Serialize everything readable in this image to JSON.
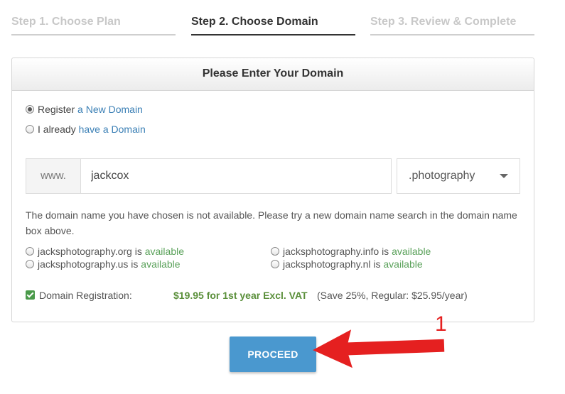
{
  "steps": [
    {
      "label": "Step 1. Choose Plan",
      "active": false
    },
    {
      "label": "Step 2. Choose Domain",
      "active": true
    },
    {
      "label": "Step 3. Review & Complete",
      "active": false
    }
  ],
  "panel": {
    "title": "Please Enter Your Domain",
    "option_register": {
      "prefix": "Register",
      "link": "a New Domain",
      "checked": true
    },
    "option_existing": {
      "prefix": "I already",
      "link": "have a Domain",
      "checked": false
    },
    "prefix": "www.",
    "domain_value": "jackcox",
    "tld_selected": ".photography",
    "message": "The domain name you have chosen is not available. Please try a new domain name search in the domain name box above.",
    "suggestions": [
      {
        "domain": "jacksphotography.org",
        "is": "is",
        "status": "available"
      },
      {
        "domain": "jacksphotography.info",
        "is": "is",
        "status": "available"
      },
      {
        "domain": "jacksphotography.us",
        "is": "is",
        "status": "available"
      },
      {
        "domain": "jacksphotography.nl",
        "is": "is",
        "status": "available"
      }
    ],
    "registration": {
      "label": "Domain Registration:",
      "price": "$19.95 for 1st year Excl. VAT",
      "savings": "(Save 25%, Regular: $25.95/year)",
      "checked": true
    }
  },
  "proceed_label": "PROCEED",
  "annotation": "1",
  "colors": {
    "accent": "#4a98cf",
    "available": "#5aa15a",
    "price": "#5a8f3a",
    "arrow": "#e52020"
  }
}
